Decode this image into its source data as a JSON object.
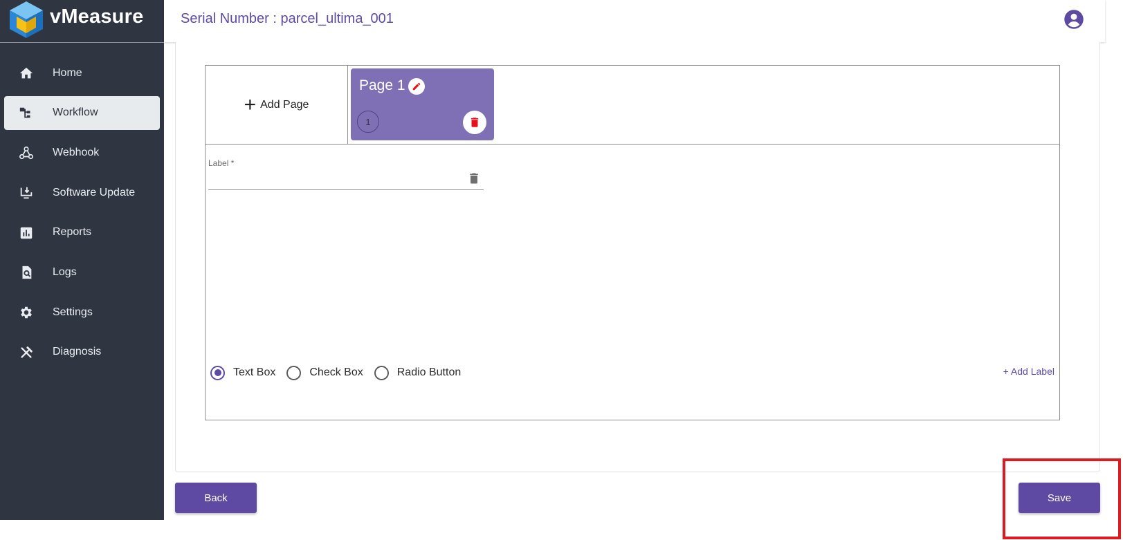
{
  "brand": {
    "name": "vMeasure"
  },
  "header": {
    "title": "Serial Number : parcel_ultima_001"
  },
  "sidebar": {
    "items": [
      {
        "label": "Home",
        "icon": "home-icon",
        "active": false
      },
      {
        "label": "Workflow",
        "icon": "workflow-icon",
        "active": true
      },
      {
        "label": "Webhook",
        "icon": "webhook-icon",
        "active": false
      },
      {
        "label": "Software Update",
        "icon": "software-update-icon",
        "active": false
      },
      {
        "label": "Reports",
        "icon": "reports-icon",
        "active": false
      },
      {
        "label": "Logs",
        "icon": "logs-icon",
        "active": false
      },
      {
        "label": "Settings",
        "icon": "gear-icon",
        "active": false
      },
      {
        "label": "Diagnosis",
        "icon": "tools-icon",
        "active": false
      }
    ]
  },
  "editor": {
    "add_page_label": "Add Page",
    "pages": [
      {
        "name": "Page 1",
        "number": "1"
      }
    ],
    "label_field": {
      "label": "Label *",
      "value": ""
    },
    "field_types": [
      {
        "label": "Text Box",
        "selected": true
      },
      {
        "label": "Check Box",
        "selected": false
      },
      {
        "label": "Radio Button",
        "selected": false
      }
    ],
    "add_label": "+ Add Label"
  },
  "actions": {
    "back_label": "Back",
    "save_label": "Save"
  },
  "colors": {
    "sidebar_bg": "#2f3541",
    "accent": "#5f4aa3",
    "page_tile": "#7f70b5",
    "delete": "#e8101a",
    "highlight": "#dd1a1f"
  }
}
